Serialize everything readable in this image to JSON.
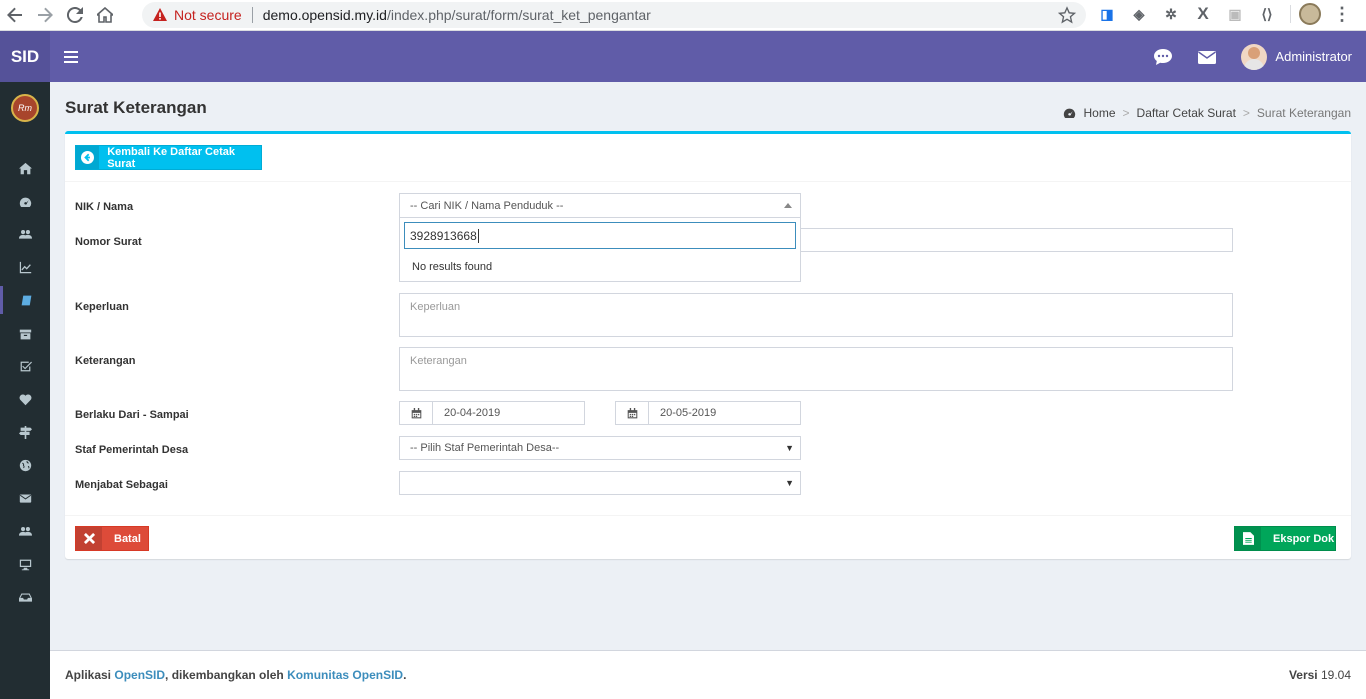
{
  "browser": {
    "not_secure": "Not secure",
    "url_host": "demo.opensid.my.id",
    "url_path": "/index.php/surat/form/surat_ket_pengantar"
  },
  "header": {
    "logo": "SID",
    "username": "Administrator"
  },
  "page": {
    "title": "Surat Keterangan",
    "breadcrumb": [
      "Home",
      "Daftar Cetak Surat",
      "Surat Keterangan"
    ]
  },
  "buttons": {
    "back": "Kembali Ke Daftar Cetak Surat",
    "batal": "Batal",
    "ekspor": "Ekspor Dok"
  },
  "form": {
    "nik_label": "NIK / Nama",
    "nik_placeholder": "-- Cari NIK / Nama Penduduk --",
    "nik_search_value": "3928913668",
    "no_results": "No results found",
    "nomor_label": "Nomor Surat",
    "keperluan_label": "Keperluan",
    "keperluan_placeholder": "Keperluan",
    "keterangan_label": "Keterangan",
    "keterangan_placeholder": "Keterangan",
    "berlaku_label": "Berlaku Dari - Sampai",
    "date_from": "20-04-2019",
    "date_to": "20-05-2019",
    "staf_label": "Staf Pemerintah Desa",
    "staf_value": "-- Pilih Staf Pemerintah Desa--",
    "menjabat_label": "Menjabat Sebagai",
    "menjabat_value": ""
  },
  "footer": {
    "prefix": "Aplikasi ",
    "app_link": "OpenSID",
    "middle": ", dikembangkan oleh ",
    "community_link": "Komunitas OpenSID",
    "suffix": ".",
    "version_label": "Versi ",
    "version_number": "19.04"
  },
  "colors": {
    "header": "#605ca8",
    "sidebar": "#222d32",
    "info": "#00c0ef",
    "danger": "#dd4b39",
    "success": "#00a65a"
  }
}
